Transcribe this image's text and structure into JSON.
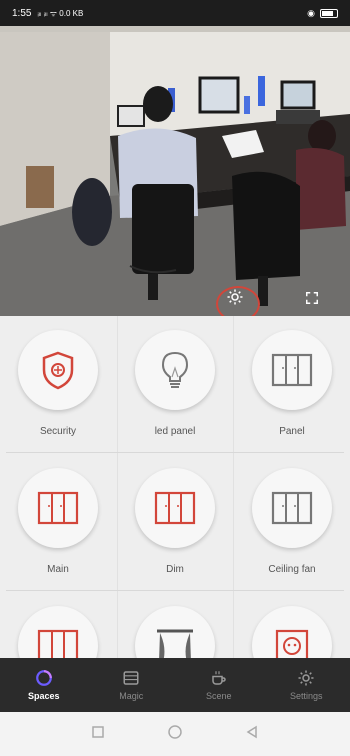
{
  "status_bar": {
    "time": "1:55",
    "signal_text": "ᵢₗₗ ᵢₗₗ ᯤ 0.0 KB"
  },
  "camera": {
    "alt": "live camera view"
  },
  "tiles": [
    {
      "label": "Security",
      "icon": "shield-icon"
    },
    {
      "label": "led panel",
      "icon": "bulb-icon"
    },
    {
      "label": "Panel",
      "icon": "panel-icon"
    },
    {
      "label": "Main",
      "icon": "panel-icon"
    },
    {
      "label": "Dim",
      "icon": "panel-icon"
    },
    {
      "label": "Ceiling fan",
      "icon": "panel-icon"
    },
    {
      "label": "",
      "icon": "panel-icon"
    },
    {
      "label": "",
      "icon": "curtain-icon"
    },
    {
      "label": "",
      "icon": "socket-icon"
    }
  ],
  "nav": [
    {
      "label": "Spaces",
      "icon": "spaces-icon",
      "active": true
    },
    {
      "label": "Magic",
      "icon": "magic-icon",
      "active": false
    },
    {
      "label": "Scene",
      "icon": "scene-icon",
      "active": false
    },
    {
      "label": "Settings",
      "icon": "settings-icon",
      "active": false
    }
  ],
  "colors": {
    "accent": "#d2463a",
    "nav_bg": "#2b2b2b",
    "active_nav": "#6c5cff"
  }
}
